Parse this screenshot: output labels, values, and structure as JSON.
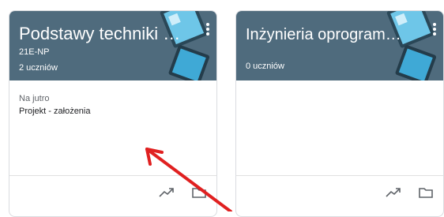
{
  "cards": [
    {
      "title": "Podstawy techniki mi…",
      "section": "21E-NP",
      "students": "2 uczniów",
      "due_heading": "Na jutro",
      "assignment": "Projekt - założenia",
      "banner_color": "#4f6b7d"
    },
    {
      "title": "Inżynieria oprogramo…",
      "section": "",
      "students": "0 uczniów",
      "due_heading": "",
      "assignment": "",
      "banner_color": "#4f6b7d"
    }
  ],
  "icons": {
    "more": "more-vert-icon",
    "trend": "trending-up-icon",
    "folder": "folder-icon"
  },
  "annotation_color": "#e02020"
}
